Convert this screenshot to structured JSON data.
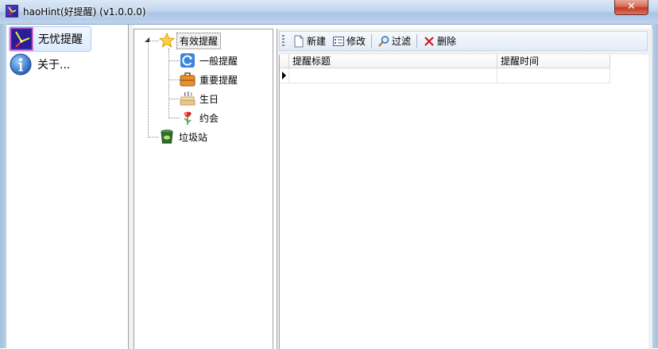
{
  "window": {
    "title": "haoHint(好提醒) (v1.0.0.0)",
    "close_label": "✕",
    "icon": "app-clock-icon"
  },
  "nav": {
    "items": [
      {
        "label": "无忧提醒",
        "icon": "clock-icon",
        "selected": true
      },
      {
        "label": "关于...",
        "icon": "info-icon",
        "selected": false
      }
    ]
  },
  "tree": {
    "root": {
      "label": "有效提醒",
      "icon": "star-icon",
      "expander": "◢"
    },
    "children": [
      {
        "label": "一般提醒",
        "icon": "refresh-icon"
      },
      {
        "label": "重要提醒",
        "icon": "briefcase-icon"
      },
      {
        "label": "生日",
        "icon": "cake-icon"
      },
      {
        "label": "约会",
        "icon": "flower-icon"
      }
    ],
    "trash": {
      "label": "垃圾站",
      "icon": "trash-icon"
    }
  },
  "toolbar": {
    "new_label": "新建",
    "edit_label": "修改",
    "filter_label": "过滤",
    "delete_label": "删除"
  },
  "grid": {
    "columns": [
      "提醒标题",
      "提醒时间"
    ]
  },
  "colors": {
    "accent": "#3b6bbf",
    "selection_bg": "#dcebfc",
    "delete_red": "#d01c1c"
  }
}
